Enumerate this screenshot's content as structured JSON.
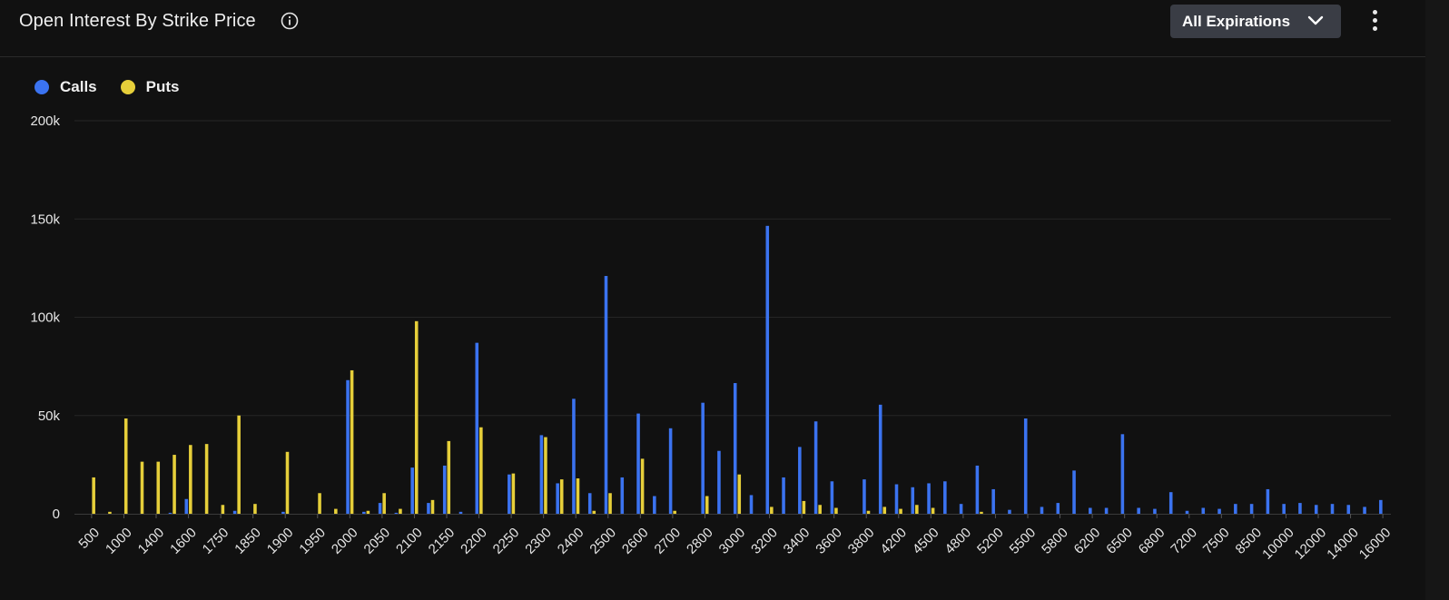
{
  "header": {
    "title": "Open Interest By Strike Price",
    "info_icon": "info-circle-icon",
    "expirations_label": "All Expirations",
    "expirations_icon": "chevron-down-icon",
    "menu_icon": "kebab-menu-icon"
  },
  "colors": {
    "background": "#111111",
    "calls": "#3b73f0",
    "puts": "#e6cf3a",
    "grid": "#262626"
  },
  "chart_data": {
    "type": "bar",
    "title": "Open Interest By Strike Price",
    "xlabel": "",
    "ylabel": "",
    "ylim": [
      0,
      200000
    ],
    "yticks": [
      0,
      50000,
      100000,
      150000,
      200000
    ],
    "ytick_labels": [
      "0",
      "50k",
      "100k",
      "150k",
      "200k"
    ],
    "grid": true,
    "legend_position": "top-left",
    "categories": [
      "500",
      "800",
      "1000",
      "1200",
      "1400",
      "1500",
      "1600",
      "1700",
      "1750",
      "1800",
      "1850",
      "1875",
      "1900",
      "1925",
      "1950",
      "1975",
      "2000",
      "2025",
      "2050",
      "2075",
      "2100",
      "2125",
      "2150",
      "2175",
      "2200",
      "2225",
      "2250",
      "2275",
      "2300",
      "2350",
      "2400",
      "2450",
      "2500",
      "2550",
      "2600",
      "2650",
      "2700",
      "2750",
      "2800",
      "2900",
      "3000",
      "3100",
      "3200",
      "3300",
      "3400",
      "3500",
      "3600",
      "3700",
      "3800",
      "4000",
      "4200",
      "4400",
      "4500",
      "4600",
      "4800",
      "5000",
      "5200",
      "5400",
      "5500",
      "5600",
      "5800",
      "6000",
      "6200",
      "6400",
      "6500",
      "6600",
      "6800",
      "7000",
      "7200",
      "7400",
      "7500",
      "8000",
      "8500",
      "9000",
      "10000",
      "11000",
      "12000",
      "13000",
      "14000",
      "15000",
      "16000"
    ],
    "tick_labels_shown": [
      "500",
      "1000",
      "1400",
      "1600",
      "1750",
      "1850",
      "1900",
      "1950",
      "2000",
      "2050",
      "2100",
      "2150",
      "2200",
      "2250",
      "2300",
      "2400",
      "2500",
      "2600",
      "2700",
      "2800",
      "3000",
      "3200",
      "3400",
      "3600",
      "3800",
      "4200",
      "4500",
      "4800",
      "5200",
      "5500",
      "5800",
      "6200",
      "6500",
      "6800",
      "7200",
      "7500",
      "8500",
      "10000",
      "12000",
      "14000",
      "16000"
    ],
    "series": [
      {
        "name": "Calls",
        "color": "#3b73f0",
        "values": [
          0,
          0,
          0,
          0,
          0,
          500,
          7500,
          0,
          0,
          1500,
          0,
          0,
          1000,
          0,
          0,
          0,
          68000,
          1000,
          5500,
          500,
          23500,
          5500,
          24500,
          1000,
          87000,
          0,
          20000,
          0,
          40000,
          15500,
          58500,
          10500,
          121000,
          18500,
          51000,
          9000,
          43500,
          0,
          56500,
          32000,
          66500,
          9500,
          146500,
          18500,
          34000,
          47000,
          16500,
          0,
          17500,
          55500,
          15000,
          13500,
          15500,
          16500,
          5000,
          24500,
          12500,
          2000,
          48500,
          3500,
          5500,
          22000,
          3000,
          3000,
          40500,
          3000,
          2500,
          11000,
          1500,
          3000,
          2500,
          5000,
          5000,
          12500,
          5000,
          5500,
          4500,
          5000,
          4500,
          3500,
          7000
        ]
      },
      {
        "name": "Puts",
        "color": "#e6cf3a",
        "values": [
          18500,
          1000,
          48500,
          26500,
          26500,
          30000,
          35000,
          35500,
          4500,
          50000,
          5000,
          0,
          31500,
          0,
          10500,
          2500,
          73000,
          1500,
          10500,
          2500,
          98000,
          7000,
          37000,
          0,
          44000,
          0,
          20500,
          0,
          39000,
          17500,
          18000,
          1500,
          10500,
          0,
          28000,
          0,
          1500,
          0,
          9000,
          0,
          20000,
          0,
          3500,
          0,
          6500,
          4500,
          3000,
          0,
          1500,
          3500,
          2500,
          4500,
          3000,
          0,
          0,
          1000,
          0,
          0,
          0,
          0,
          0,
          0,
          0,
          0,
          0,
          0,
          0,
          0,
          0,
          0,
          0,
          0,
          0,
          0,
          0,
          0,
          0,
          0,
          0,
          0,
          0
        ]
      }
    ]
  }
}
